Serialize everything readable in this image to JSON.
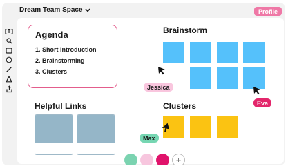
{
  "header": {
    "space_title": "Dream Team Space",
    "profile_label": "Profile"
  },
  "toolbar": {
    "text_tool_label": "[T]",
    "tools": [
      "text-icon",
      "search-icon",
      "rectangle-icon",
      "circle-icon",
      "line-icon",
      "triangle-icon",
      "share-icon"
    ]
  },
  "agenda": {
    "title": "Agenda",
    "items": [
      "1. Short introduction",
      "2. Brainstorming",
      "3. Clusters"
    ]
  },
  "brainstorm": {
    "title": "Brainstorm"
  },
  "helpful_links": {
    "title": "Helpful Links"
  },
  "clusters": {
    "title": "Clusters"
  },
  "collaborators": [
    {
      "name": "Jessica",
      "color": "#f9c6de"
    },
    {
      "name": "Eva",
      "color": "#e3266b"
    },
    {
      "name": "Max",
      "color": "#76d6b2"
    }
  ],
  "palette": {
    "colors": [
      "#7bd3b0",
      "#f7c6de",
      "#e0136b"
    ],
    "add_label": "+"
  },
  "colors": {
    "sticky_blue": "#55c1fb",
    "sticky_yellow": "#fbc312",
    "agenda_border": "#e35d8c",
    "profile": "#ef78a6"
  }
}
